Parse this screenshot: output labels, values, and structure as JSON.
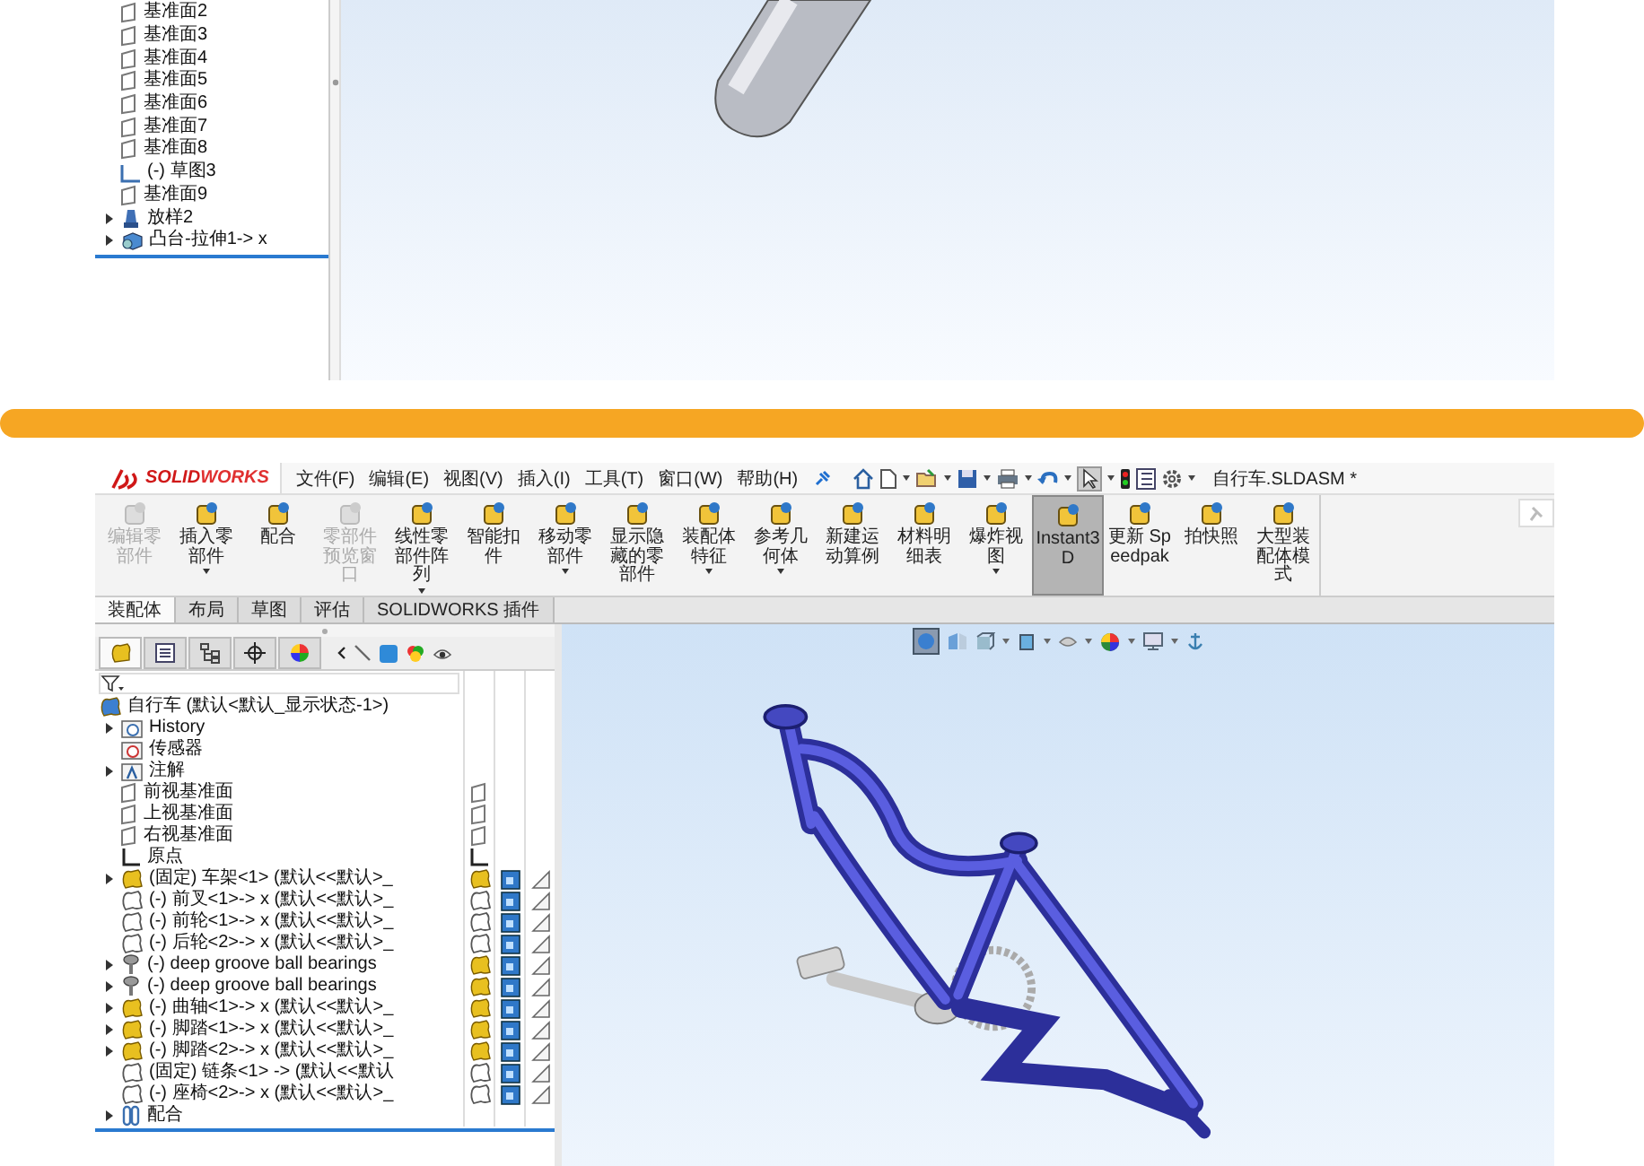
{
  "top_panel": {
    "tree": [
      {
        "label": "基准面2",
        "kind": "plane",
        "expandable": false
      },
      {
        "label": "基准面3",
        "kind": "plane",
        "expandable": false
      },
      {
        "label": "基准面4",
        "kind": "plane",
        "expandable": false
      },
      {
        "label": "基准面5",
        "kind": "plane",
        "expandable": false
      },
      {
        "label": "基准面6",
        "kind": "plane",
        "expandable": false
      },
      {
        "label": "基准面7",
        "kind": "plane",
        "expandable": false
      },
      {
        "label": "基准面8",
        "kind": "plane",
        "expandable": false
      },
      {
        "label": "(-) 草图3",
        "kind": "sketch",
        "expandable": false
      },
      {
        "label": "基准面9",
        "kind": "plane",
        "expandable": false
      },
      {
        "label": "放样2",
        "kind": "loft",
        "expandable": true
      },
      {
        "label": "凸台-拉伸1-> x",
        "kind": "extrude",
        "expandable": true
      }
    ]
  },
  "window": {
    "logo": [
      "SOLID",
      "WORKS"
    ],
    "menu": [
      "文件(F)",
      "编辑(E)",
      "视图(V)",
      "插入(I)",
      "工具(T)",
      "窗口(W)",
      "帮助(H)"
    ],
    "title": "自行车.SLDASM *",
    "commands": [
      {
        "label": "编辑零部件",
        "disabled": true,
        "selected": false,
        "dropdown": false
      },
      {
        "label": "插入零部件",
        "disabled": false,
        "selected": false,
        "dropdown": true
      },
      {
        "label": "配合",
        "disabled": false,
        "selected": false,
        "dropdown": false
      },
      {
        "label": "零部件预览窗口",
        "disabled": true,
        "selected": false,
        "dropdown": false
      },
      {
        "label": "线性零部件阵列",
        "disabled": false,
        "selected": false,
        "dropdown": true
      },
      {
        "label": "智能扣件",
        "disabled": false,
        "selected": false,
        "dropdown": false
      },
      {
        "label": "移动零部件",
        "disabled": false,
        "selected": false,
        "dropdown": true
      },
      {
        "label": "显示隐藏的零部件",
        "disabled": false,
        "selected": false,
        "dropdown": false
      },
      {
        "label": "装配体特征",
        "disabled": false,
        "selected": false,
        "dropdown": true
      },
      {
        "label": "参考几何体",
        "disabled": false,
        "selected": false,
        "dropdown": true
      },
      {
        "label": "新建运动算例",
        "disabled": false,
        "selected": false,
        "dropdown": false
      },
      {
        "label": "材料明细表",
        "disabled": false,
        "selected": false,
        "dropdown": false
      },
      {
        "label": "爆炸视图",
        "disabled": false,
        "selected": false,
        "dropdown": true
      },
      {
        "label": "Instant3D",
        "disabled": false,
        "selected": true,
        "dropdown": false
      },
      {
        "label": "更新 Speedpak",
        "disabled": false,
        "selected": false,
        "dropdown": false
      },
      {
        "label": "拍快照",
        "disabled": false,
        "selected": false,
        "dropdown": false
      },
      {
        "label": "大型装配体模式",
        "disabled": false,
        "selected": false,
        "dropdown": false
      }
    ],
    "tabs": [
      {
        "label": "装配体",
        "selected": true
      },
      {
        "label": "布局",
        "selected": false
      },
      {
        "label": "草图",
        "selected": false
      },
      {
        "label": "评估",
        "selected": false
      },
      {
        "label": "SOLIDWORKS 插件",
        "selected": false
      }
    ],
    "panel_tabs": [
      {
        "selected": true
      },
      {
        "selected": false
      },
      {
        "selected": false
      },
      {
        "selected": false
      },
      {
        "selected": false
      }
    ],
    "tree": {
      "label": "自行车 (默认<默认_显示状态-1>)",
      "kind": "assembly",
      "expandable": false,
      "children": [
        {
          "label": "History",
          "kind": "history",
          "expandable": true
        },
        {
          "label": "传感器",
          "kind": "sensor",
          "expandable": false
        },
        {
          "label": "注解",
          "kind": "annotation",
          "expandable": true
        },
        {
          "label": "前视基准面",
          "kind": "plane",
          "expandable": false
        },
        {
          "label": "上视基准面",
          "kind": "plane",
          "expandable": false
        },
        {
          "label": "右视基准面",
          "kind": "plane",
          "expandable": false
        },
        {
          "label": "原点",
          "kind": "origin",
          "expandable": false
        },
        {
          "label": "(固定) 车架<1> (默认<<默认>_",
          "kind": "part-solid",
          "expandable": true
        },
        {
          "label": "(-) 前叉<1>-> x (默认<<默认>_",
          "kind": "part-outline",
          "expandable": false
        },
        {
          "label": "(-) 前轮<1>-> x (默认<<默认>_",
          "kind": "part-outline",
          "expandable": false
        },
        {
          "label": "(-) 后轮<2>-> x (默认<<默认>_",
          "kind": "part-outline",
          "expandable": false
        },
        {
          "label": "(-) deep groove ball bearings",
          "kind": "bearing",
          "expandable": true
        },
        {
          "label": "(-) deep groove ball bearings",
          "kind": "bearing",
          "expandable": true
        },
        {
          "label": "(-) 曲轴<1>-> x (默认<<默认>_",
          "kind": "part-solid",
          "expandable": true
        },
        {
          "label": "(-) 脚踏<1>-> x (默认<<默认>_",
          "kind": "part-solid",
          "expandable": true
        },
        {
          "label": "(-) 脚踏<2>-> x (默认<<默认>_",
          "kind": "part-solid",
          "expandable": true
        },
        {
          "label": "(固定) 链条<1> -> (默认<<默认",
          "kind": "part-outline",
          "expandable": false
        },
        {
          "label": "(-) 座椅<2>-> x (默认<<默认>_",
          "kind": "part-outline",
          "expandable": false
        },
        {
          "label": "配合",
          "kind": "mates",
          "expandable": true
        }
      ]
    }
  }
}
